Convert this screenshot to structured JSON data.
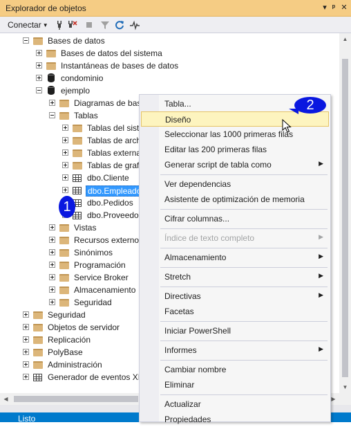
{
  "window": {
    "title": "Explorador de objetos"
  },
  "toolbar": {
    "connect_label": "Conectar"
  },
  "tree": {
    "rows": [
      {
        "label": "Bases de datos",
        "depth": 1,
        "expander": "minus",
        "icon": "folder"
      },
      {
        "label": "Bases de datos del sistema",
        "depth": 2,
        "expander": "plus",
        "icon": "folder"
      },
      {
        "label": "Instantáneas de bases de datos",
        "depth": 2,
        "expander": "plus",
        "icon": "folder"
      },
      {
        "label": "condominio",
        "depth": 2,
        "expander": "plus",
        "icon": "database"
      },
      {
        "label": "ejemplo",
        "depth": 2,
        "expander": "minus",
        "icon": "database"
      },
      {
        "label": "Diagramas de bas",
        "depth": 3,
        "expander": "plus",
        "icon": "folder"
      },
      {
        "label": "Tablas",
        "depth": 3,
        "expander": "minus",
        "icon": "folder"
      },
      {
        "label": "Tablas del siste",
        "depth": 4,
        "expander": "plus",
        "icon": "folder"
      },
      {
        "label": "Tablas de arch",
        "depth": 4,
        "expander": "plus",
        "icon": "folder"
      },
      {
        "label": "Tablas externa",
        "depth": 4,
        "expander": "plus",
        "icon": "folder"
      },
      {
        "label": "Tablas de grafo",
        "depth": 4,
        "expander": "plus",
        "icon": "folder"
      },
      {
        "label": "dbo.Cliente",
        "depth": 4,
        "expander": "plus",
        "icon": "table"
      },
      {
        "label": "dbo.Empleado",
        "depth": 4,
        "expander": "plus",
        "icon": "table",
        "selected": true
      },
      {
        "label": "dbo.Pedidos",
        "depth": 4,
        "expander": "plus",
        "icon": "table"
      },
      {
        "label": "dbo.Proveedo",
        "depth": 4,
        "expander": "plus",
        "icon": "table"
      },
      {
        "label": "Vistas",
        "depth": 3,
        "expander": "plus",
        "icon": "folder"
      },
      {
        "label": "Recursos externos",
        "depth": 3,
        "expander": "plus",
        "icon": "folder"
      },
      {
        "label": "Sinónimos",
        "depth": 3,
        "expander": "plus",
        "icon": "folder"
      },
      {
        "label": "Programación",
        "depth": 3,
        "expander": "plus",
        "icon": "folder"
      },
      {
        "label": "Service Broker",
        "depth": 3,
        "expander": "plus",
        "icon": "folder"
      },
      {
        "label": "Almacenamiento",
        "depth": 3,
        "expander": "plus",
        "icon": "folder"
      },
      {
        "label": "Seguridad",
        "depth": 3,
        "expander": "plus",
        "icon": "folder"
      },
      {
        "label": "Seguridad",
        "depth": 1,
        "expander": "plus",
        "icon": "folder"
      },
      {
        "label": "Objetos de servidor",
        "depth": 1,
        "expander": "plus",
        "icon": "folder"
      },
      {
        "label": "Replicación",
        "depth": 1,
        "expander": "plus",
        "icon": "folder"
      },
      {
        "label": "PolyBase",
        "depth": 1,
        "expander": "plus",
        "icon": "folder"
      },
      {
        "label": "Administración",
        "depth": 1,
        "expander": "plus",
        "icon": "folder"
      },
      {
        "label": "Generador de eventos XE",
        "depth": 1,
        "expander": "plus",
        "icon": "xevent"
      }
    ]
  },
  "context_menu": {
    "items": [
      {
        "label": "Tabla...",
        "submenu": false
      },
      {
        "label": "Diseño",
        "hover": true
      },
      {
        "label": "Seleccionar las 1000 primeras filas"
      },
      {
        "label": "Editar las 200 primeras filas"
      },
      {
        "label": "Generar script de tabla como",
        "submenu": true
      },
      {
        "separator": true
      },
      {
        "label": "Ver dependencias"
      },
      {
        "label": "Asistente de optimización de memoria"
      },
      {
        "separator": true
      },
      {
        "label": "Cifrar columnas..."
      },
      {
        "separator": true
      },
      {
        "label": "Índice de texto completo",
        "submenu": true,
        "disabled": true
      },
      {
        "separator": true
      },
      {
        "label": "Almacenamiento",
        "submenu": true
      },
      {
        "separator": true
      },
      {
        "label": "Stretch",
        "submenu": true
      },
      {
        "separator": true
      },
      {
        "label": "Directivas",
        "submenu": true
      },
      {
        "label": "Facetas"
      },
      {
        "separator": true
      },
      {
        "label": "Iniciar PowerShell"
      },
      {
        "separator": true
      },
      {
        "label": "Informes",
        "submenu": true
      },
      {
        "separator": true
      },
      {
        "label": "Cambiar nombre"
      },
      {
        "label": "Eliminar"
      },
      {
        "separator": true
      },
      {
        "label": "Actualizar"
      },
      {
        "label": "Propiedades"
      }
    ]
  },
  "callouts": {
    "step1": "1",
    "step2": "2"
  },
  "status": {
    "text": "Listo"
  },
  "colors": {
    "titlebar": "#f5cc84",
    "selection": "#3399ff",
    "callout": "#0a18e0",
    "statusbar": "#007acc",
    "menu_hover": "#fdf4bf"
  }
}
